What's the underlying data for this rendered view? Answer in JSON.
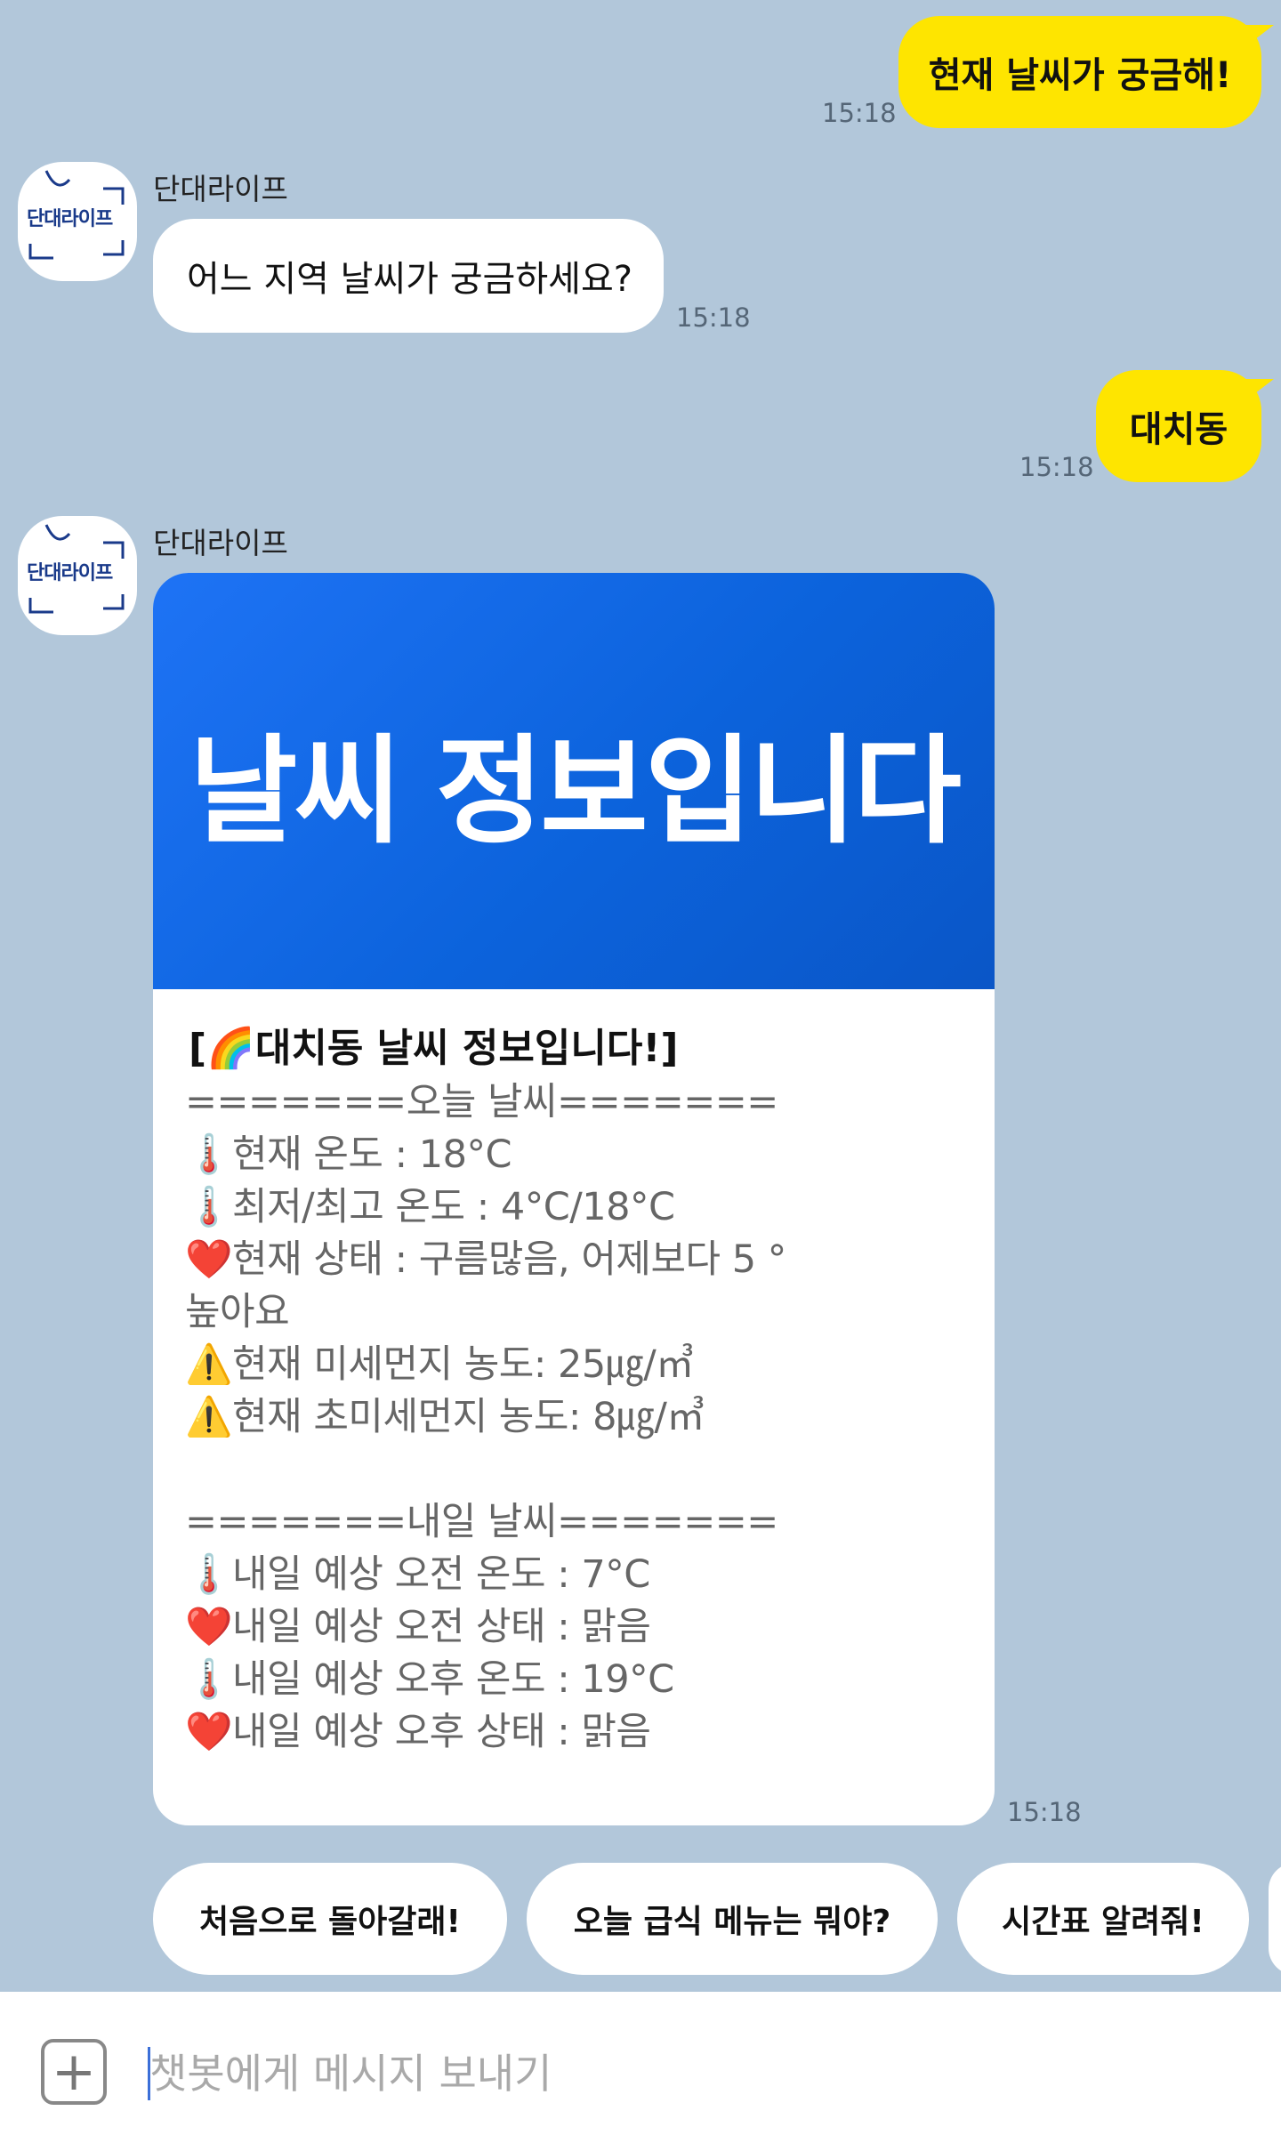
{
  "bot": {
    "name": "단대라이프",
    "avatar_text": "단대라이프"
  },
  "messages": {
    "user1": {
      "text": "현재 날씨가 궁금해!",
      "time": "15:18"
    },
    "bot1": {
      "text": "어느 지역 날씨가 궁금하세요?",
      "time": "15:18"
    },
    "user2": {
      "text": "대치동",
      "time": "15:18"
    },
    "card": {
      "banner": "날씨 정보입니다",
      "title": "[🌈대치동 날씨 정보입니다!]",
      "lines": [
        "=======오늘 날씨=======",
        "🌡️현재 온도 : 18°C",
        "🌡️최저/최고 온도 : 4°C/18°C",
        "❤️현재 상태 : 구름많음, 어제보다 5 °",
        "높아요",
        "⚠️현재 미세먼지 농도: 25㎍/㎥",
        "⚠️현재 초미세먼지 농도: 8㎍/㎥",
        "",
        "=======내일 날씨=======",
        "🌡️내일 예상 오전 온도 : 7°C",
        "❤️내일 예상 오전 상태 : 맑음",
        "🌡️내일 예상 오후 온도 : 19°C",
        "❤️내일 예상 오후 상태 : 맑음"
      ],
      "time": "15:18"
    }
  },
  "quick_replies": [
    "처음으로 돌아갈래!",
    "오늘 급식 메뉴는 뭐야?",
    "시간표 알려줘!"
  ],
  "input": {
    "placeholder": "챗봇에게 메시지 보내기",
    "plus_icon": "plus-icon"
  },
  "colors": {
    "background": "#b2c7da",
    "user_bubble": "#fee500",
    "banner": "#0c63dc"
  }
}
